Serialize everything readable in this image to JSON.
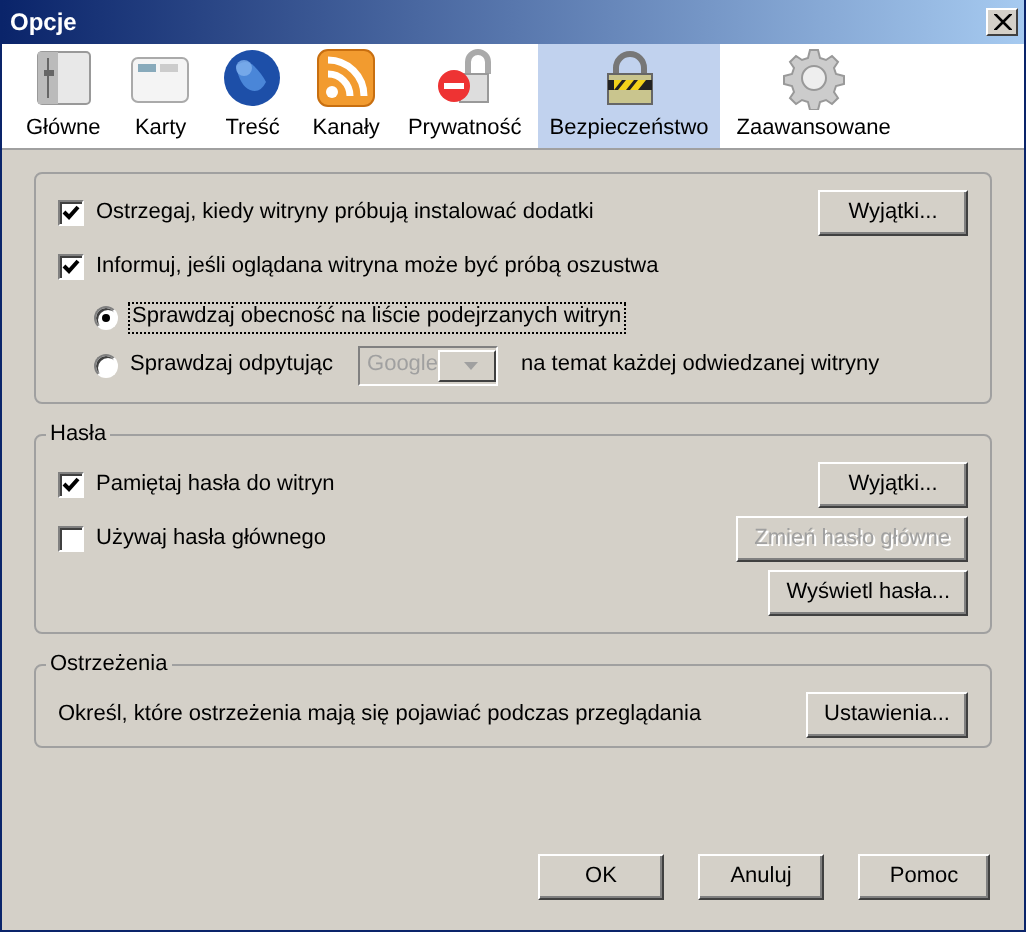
{
  "window": {
    "title": "Opcje"
  },
  "tabs": [
    {
      "label": "Główne",
      "kind": "general",
      "selected": false
    },
    {
      "label": "Karty",
      "kind": "tabs",
      "selected": false
    },
    {
      "label": "Treść",
      "kind": "content",
      "selected": false
    },
    {
      "label": "Kanały",
      "kind": "feeds",
      "selected": false
    },
    {
      "label": "Prywatność",
      "kind": "privacy",
      "selected": false
    },
    {
      "label": "Bezpieczeństwo",
      "kind": "security",
      "selected": true
    },
    {
      "label": "Zaawansowane",
      "kind": "advanced",
      "selected": false
    }
  ],
  "groups": [
    {
      "items": [
        {
          "kind": "checkbox",
          "label": "Ostrzegaj, kiedy witryny próbują instalować dodatki",
          "checked": true,
          "button": {
            "label": "Wyjątki...",
            "disabled": false
          }
        },
        {
          "kind": "checkbox",
          "label": "Informuj, jeśli oglądana witryna może być próbą oszustwa",
          "checked": true
        },
        {
          "kind": "radio",
          "label": "Sprawdzaj obecność na liście podejrzanych witryn",
          "selected": true
        },
        {
          "kind": "radio",
          "label": "Sprawdzaj odpytując",
          "selected": false,
          "dropdown": {
            "value": "Google",
            "disabled": true
          },
          "suffix": "na temat każdej odwiedzanej witryny"
        }
      ]
    },
    {
      "title": "Hasła",
      "items": [
        {
          "kind": "checkbox",
          "label": "Pamiętaj hasła do witryn",
          "checked": true,
          "button": {
            "label": "Wyjątki...",
            "disabled": false
          }
        },
        {
          "kind": "checkbox",
          "label": "Używaj hasła głównego",
          "checked": false,
          "button": {
            "label": "Zmień hasło główne",
            "disabled": true
          }
        },
        {
          "kind": "button",
          "button": {
            "label": "Wyświetl hasła...",
            "disabled": false
          }
        }
      ]
    },
    {
      "title": "Ostrzeżenia",
      "items": [
        {
          "kind": "text",
          "label": "Określ, które ostrzeżenia mają się pojawiać podczas przeglądania",
          "button": {
            "label": "Ustawienia...",
            "disabled": false
          }
        }
      ]
    }
  ],
  "buttons": [
    "OK",
    "Anuluj",
    "Pomoc"
  ]
}
